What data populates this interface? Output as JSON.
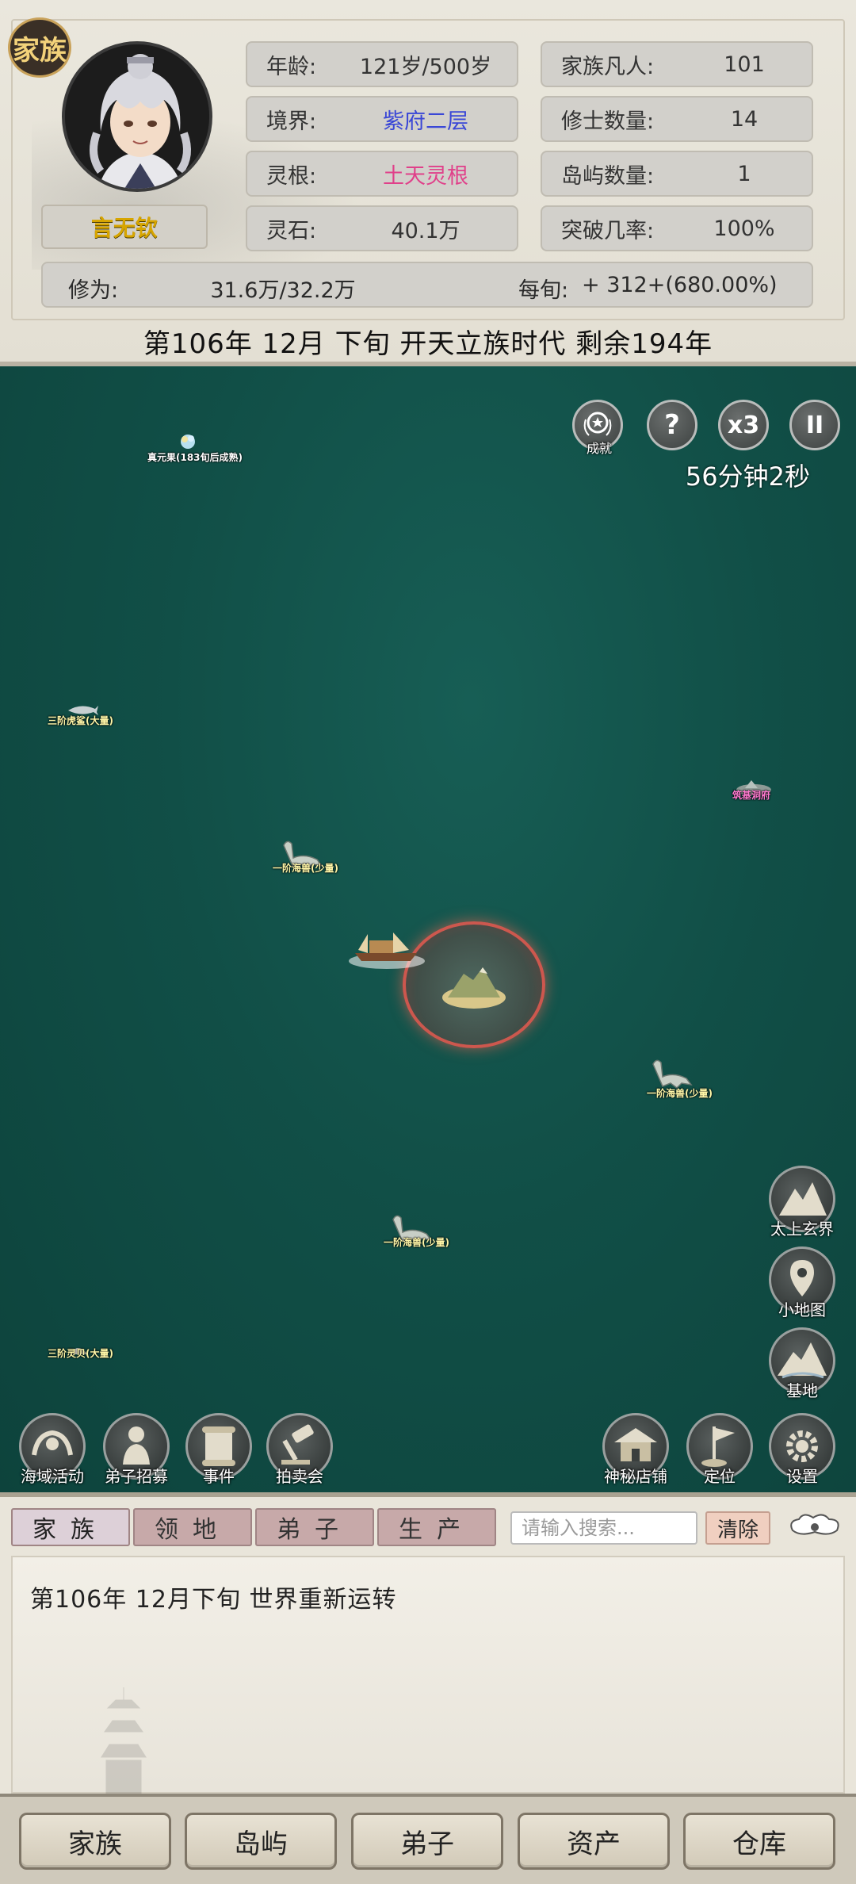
{
  "top": {
    "clan_badge": "家族",
    "char_name": "言无钦",
    "stats": {
      "age_key": "年龄:",
      "age_val": "121岁/500岁",
      "realm_key": "境界:",
      "realm_val": "紫府二层",
      "root_key": "灵根:",
      "root_val": "土天灵根",
      "stone_key": "灵石:",
      "stone_val": "40.1万",
      "mortals_key": "家族凡人:",
      "mortals_val": "101",
      "cultivators_key": "修士数量:",
      "cultivators_val": "14",
      "islands_key": "岛屿数量:",
      "islands_val": "1",
      "breakthrough_key": "突破几率:",
      "breakthrough_val": "100%"
    },
    "cultivation": {
      "key": "修为:",
      "value": "31.6万/32.2万",
      "rate_key": "每旬:",
      "rate_val": "+ 312+(680.00%)"
    },
    "date_banner": "第106年 12月 下旬  开天立族时代 剩余194年"
  },
  "map": {
    "controls": {
      "achievement": "成就",
      "help": "?",
      "speed": "x3",
      "pause": "II"
    },
    "timer": "56分钟2秒",
    "labels": {
      "l1": "真元果(183旬后成熟)",
      "l2": "三阶虎鲨(大量)",
      "l3": "筑基洞府",
      "l4": "一阶海兽(少量)",
      "l5": "一阶海兽(少量)",
      "l6": "一阶海兽(少量)",
      "l7": "三阶灵贝(大量)"
    },
    "side_buttons": {
      "taishang": "太上玄界",
      "minimap": "小地图",
      "base": "基地"
    },
    "bottom_buttons": {
      "sea_events": "海域活动",
      "recruit": "弟子招募",
      "events": "事件",
      "auction": "拍卖会",
      "shop": "神秘店铺",
      "locate": "定位",
      "settings": "设置"
    }
  },
  "log": {
    "tabs": [
      "家族",
      "领地",
      "弟子",
      "生产"
    ],
    "search_placeholder": "请输入搜索...",
    "clear": "清除",
    "entry": "第106年   12月下旬 世界重新运转"
  },
  "nav": [
    "家族",
    "岛屿",
    "弟子",
    "资产",
    "仓库"
  ]
}
